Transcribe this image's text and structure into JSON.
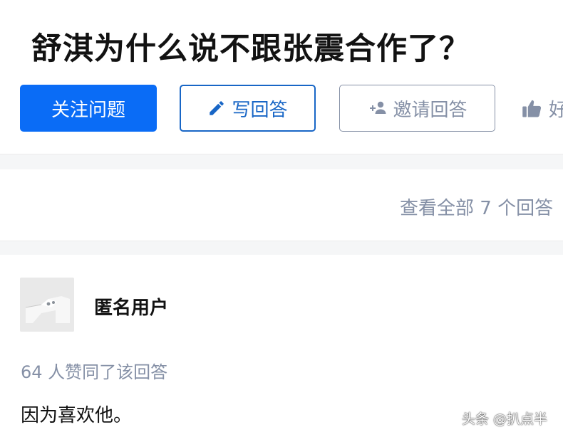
{
  "question": {
    "title": "舒淇为什么说不跟张震合作了？"
  },
  "actions": {
    "follow_label": "关注问题",
    "write_label": "写回答",
    "invite_label": "邀请回答",
    "like_label": "好",
    "icons": {
      "write": "pencil-icon",
      "invite": "add-person-icon",
      "like": "thumbs-up-icon"
    }
  },
  "answers_link": {
    "label": "查看全部 7 个回答"
  },
  "answer": {
    "author": "匿名用户",
    "vote_text": "64 人赞同了该回答",
    "content": "因为喜欢他。"
  },
  "watermark": {
    "text": "头条 @扒点半"
  },
  "colors": {
    "primary": "#0a6cf6",
    "primary_text": "#1866c6",
    "muted": "#8590a6",
    "divider_bg": "#f5f6f7"
  }
}
